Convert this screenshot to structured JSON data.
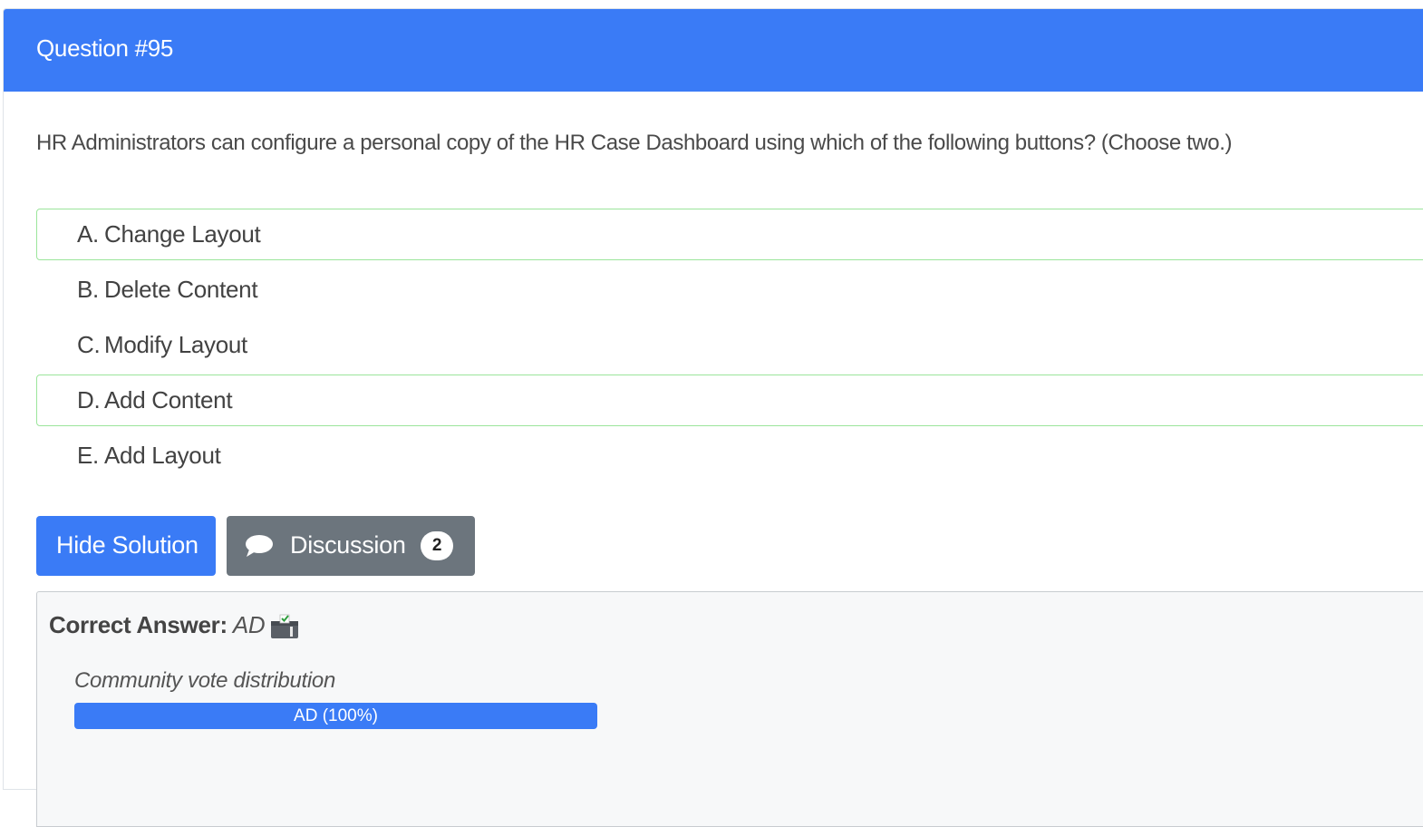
{
  "header": {
    "title": "Question #95"
  },
  "question": {
    "text": "HR Administrators can configure a personal copy of the HR Case Dashboard using which of the following buttons? (Choose two.)"
  },
  "choices": [
    {
      "letter": "A.",
      "text": "Change Layout",
      "correct": true
    },
    {
      "letter": "B.",
      "text": "Delete Content",
      "correct": false
    },
    {
      "letter": "C.",
      "text": "Modify Layout",
      "correct": false
    },
    {
      "letter": "D.",
      "text": "Add Content",
      "correct": true
    },
    {
      "letter": "E.",
      "text": "Add Layout",
      "correct": false
    }
  ],
  "buttons": {
    "hide_solution": "Hide Solution",
    "discussion": "Discussion",
    "discussion_count": "2"
  },
  "answer": {
    "label": "Correct Answer:",
    "value": "AD",
    "vote_title": "Community vote distribution",
    "votes": [
      {
        "label": "AD (100%)",
        "percent": 100
      }
    ]
  },
  "colors": {
    "primary": "#3a7bf6",
    "secondary": "#6c757d",
    "correct_border": "#9be59b"
  },
  "icons": {
    "discussion": "chat-bubble-icon",
    "reveal": "vote-box-icon"
  }
}
